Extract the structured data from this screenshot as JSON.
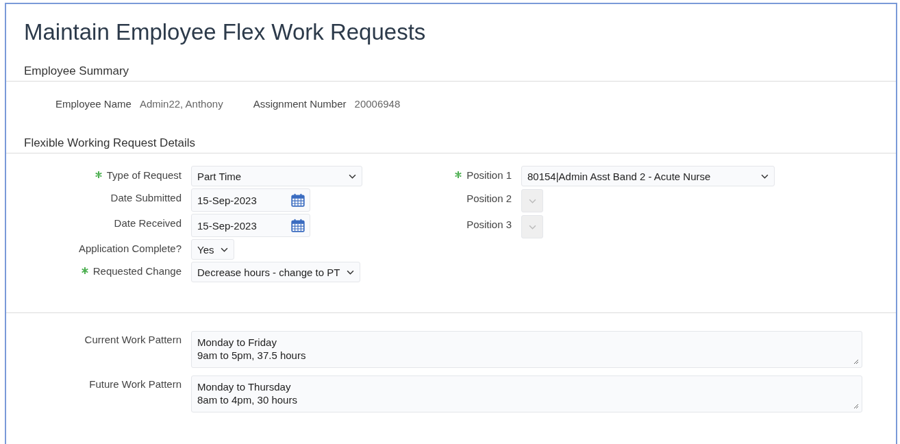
{
  "title": "Maintain Employee Flex Work Requests",
  "employee_summary": {
    "heading": "Employee Summary",
    "fields": [
      {
        "label": "Employee Name",
        "value": "Admin22, Anthony"
      },
      {
        "label": "Assignment Number",
        "value": "20006948"
      }
    ]
  },
  "request_details": {
    "heading": "Flexible Working Request Details",
    "left_fields": [
      {
        "kind": "select",
        "label": "Type of Request",
        "required": true,
        "disabled": false,
        "value": "Part Time"
      },
      {
        "kind": "date",
        "label": "Date Submitted",
        "required": false,
        "disabled": false,
        "value": "15-Sep-2023"
      },
      {
        "kind": "date",
        "label": "Date Received",
        "required": false,
        "disabled": false,
        "value": "15-Sep-2023"
      },
      {
        "kind": "select",
        "label": "Application Complete?",
        "required": false,
        "disabled": false,
        "value": "Yes"
      },
      {
        "kind": "select",
        "label": "Requested Change",
        "required": true,
        "disabled": false,
        "value": "Decrease hours - change to PT"
      }
    ],
    "right_fields": [
      {
        "kind": "select",
        "label": "Position 1",
        "required": true,
        "disabled": false,
        "value": "80154|Admin Asst Band 2 - Acute Nurse"
      },
      {
        "kind": "select",
        "label": "Position 2",
        "required": false,
        "disabled": true
      },
      {
        "kind": "select",
        "label": "Position 3",
        "required": false,
        "disabled": true
      }
    ]
  },
  "work_patterns": [
    {
      "label": "Current Work Pattern",
      "value": "Monday to Friday\n9am to 5pm, 37.5 hours"
    },
    {
      "label": "Future Work Pattern",
      "value": "Monday to Thursday\n8am to 4pm, 30 hours"
    }
  ]
}
